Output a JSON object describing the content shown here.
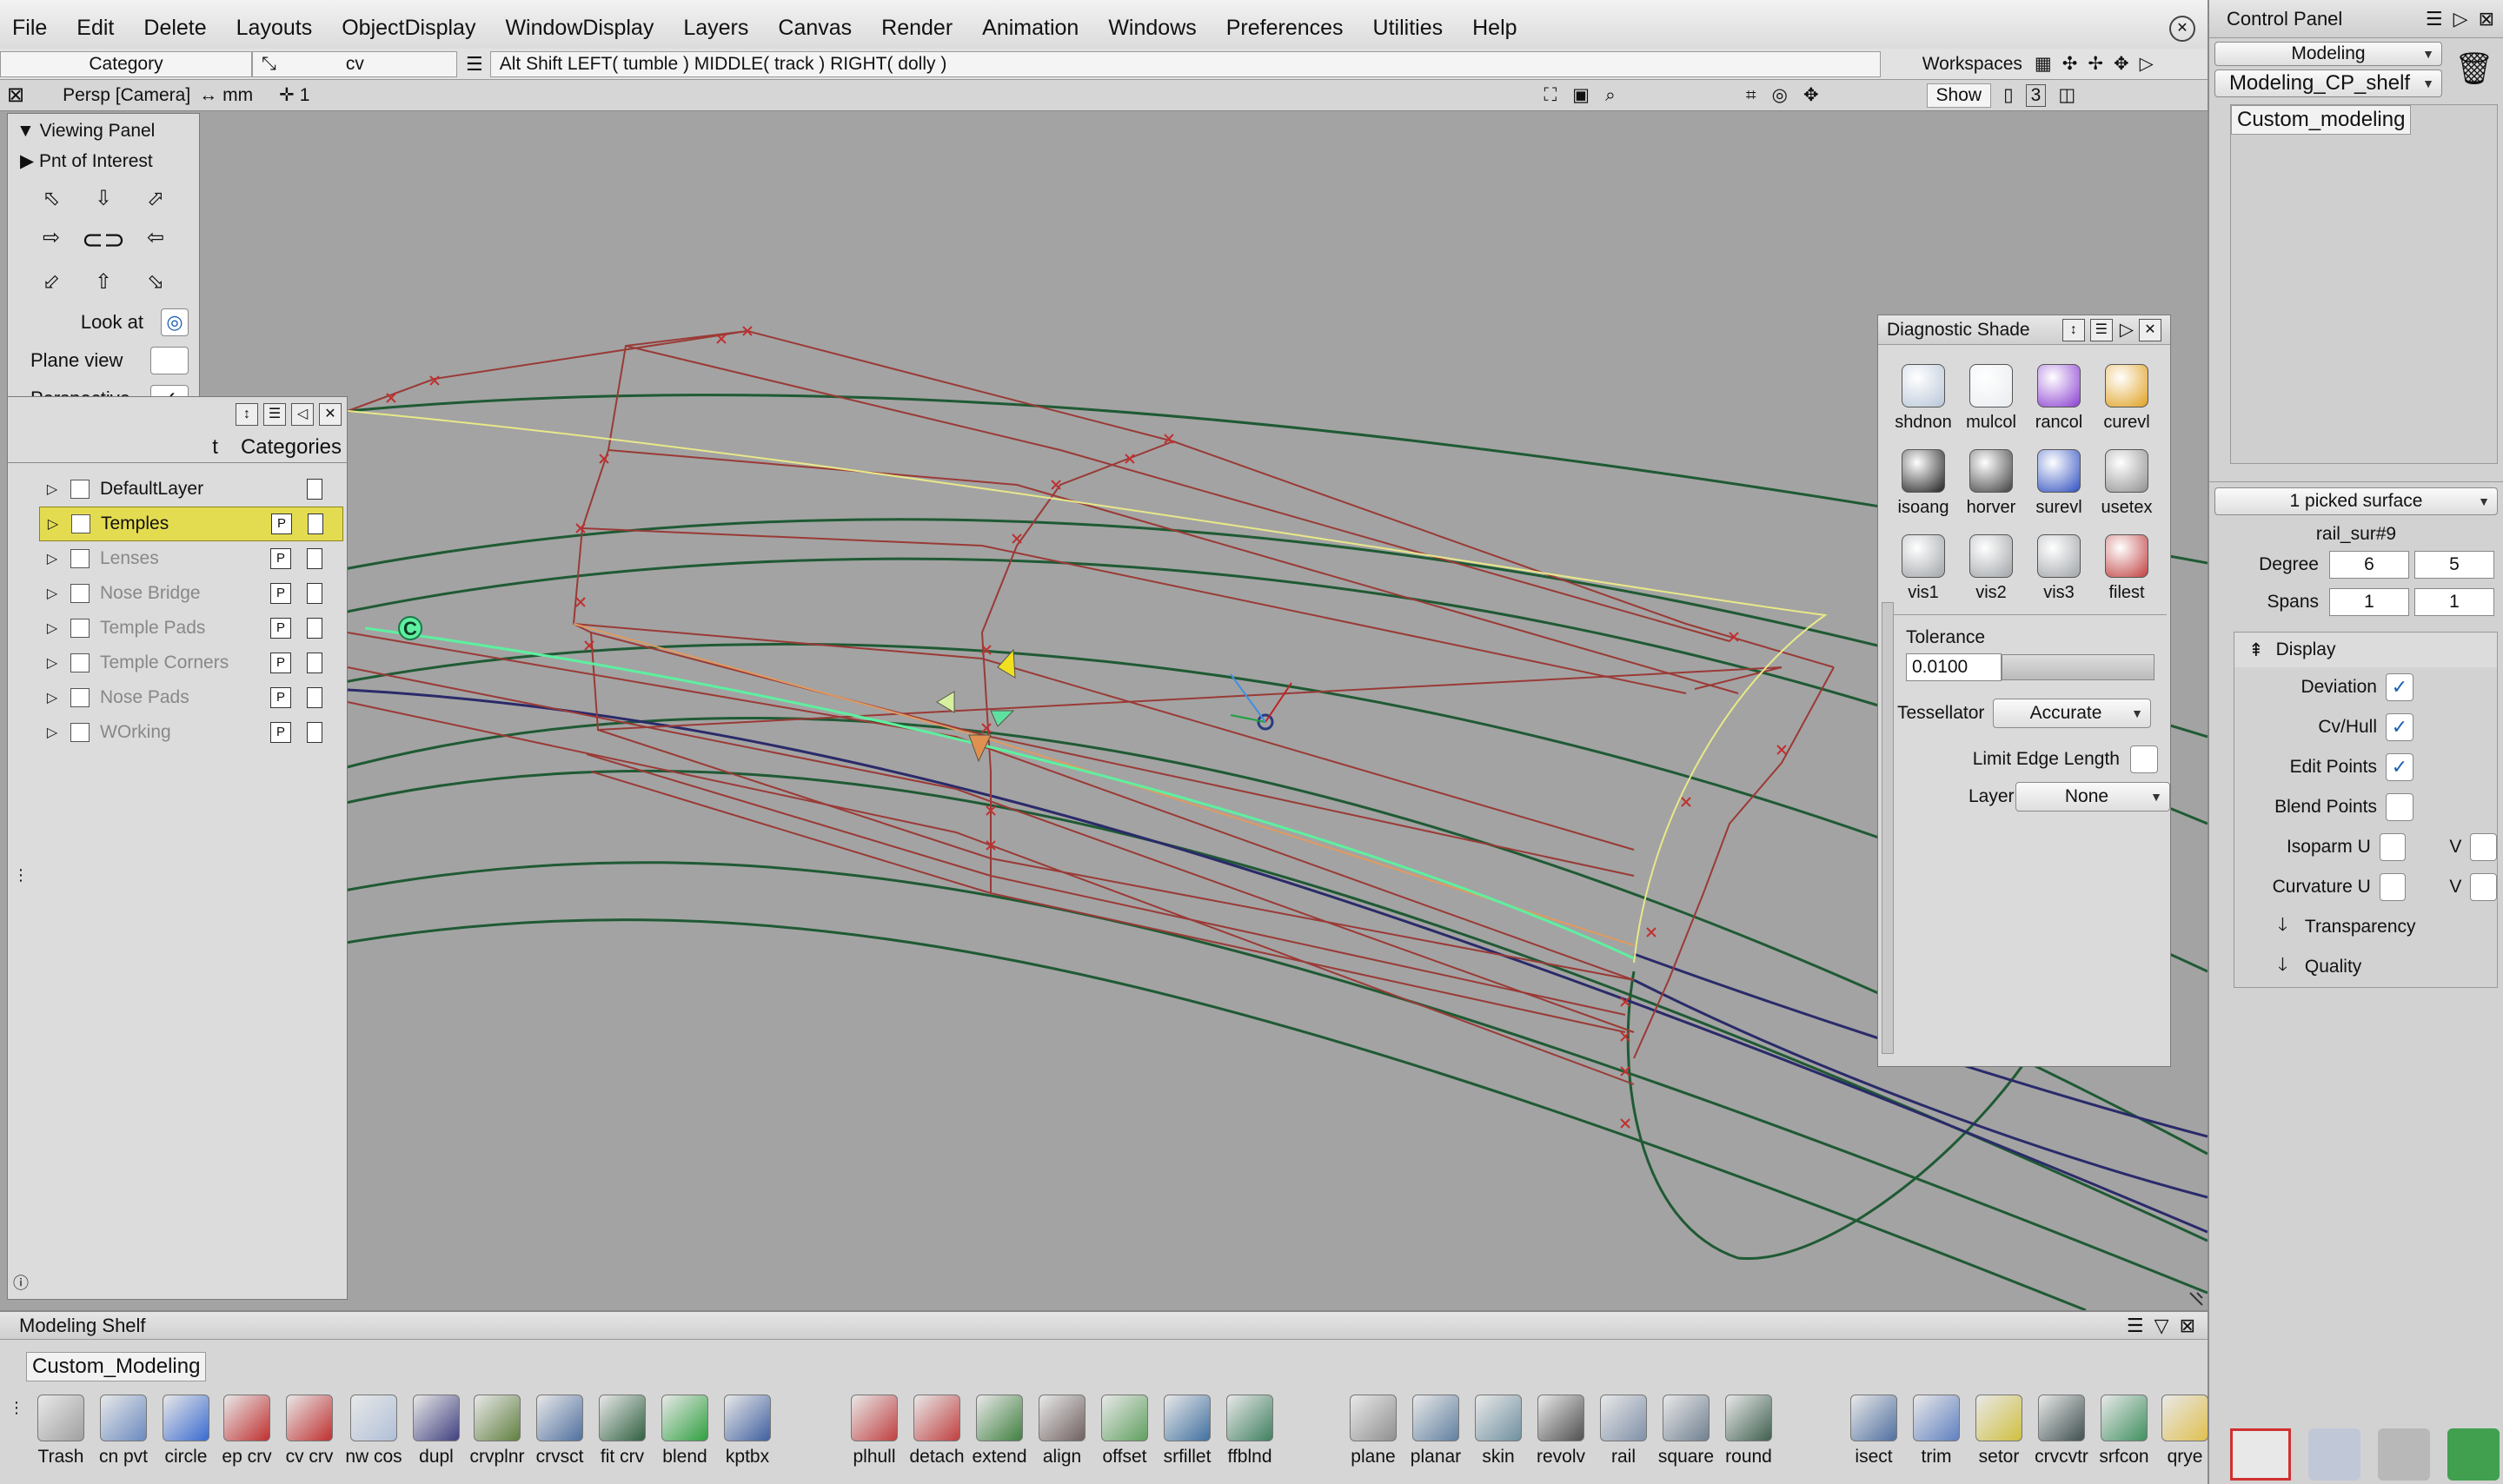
{
  "menu": [
    "File",
    "Edit",
    "Delete",
    "Layouts",
    "ObjectDisplay",
    "WindowDisplay",
    "Layers",
    "Canvas",
    "Render",
    "Animation",
    "Windows",
    "Preferences",
    "Utilities",
    "Help"
  ],
  "toolbar": {
    "category": "Category",
    "tool": "cv",
    "hint": "Alt Shift    LEFT( tumble )    MIDDLE( track )    RIGHT( dolly )",
    "workspaces": "Workspaces"
  },
  "viewport": {
    "camera": "Persp [Camera]",
    "units": "mm",
    "count": "1",
    "show_label": "Show",
    "layout_num": "3"
  },
  "viewing_panel": {
    "title": "Viewing Panel",
    "poi": "Pnt of Interest",
    "look_at": "Look at",
    "plane_view": "Plane view",
    "perspective": "Perspective"
  },
  "layers": {
    "tab_left": "t",
    "tab_right": "Categories",
    "items": [
      {
        "name": "DefaultLayer",
        "p": false,
        "selected": false,
        "dim": false
      },
      {
        "name": "Temples",
        "p": true,
        "selected": true,
        "dim": false
      },
      {
        "name": "Lenses",
        "p": true,
        "selected": false,
        "dim": true
      },
      {
        "name": "Nose Bridge",
        "p": true,
        "selected": false,
        "dim": true
      },
      {
        "name": "Temple Pads",
        "p": true,
        "selected": false,
        "dim": true
      },
      {
        "name": "Temple Corners",
        "p": true,
        "selected": false,
        "dim": true
      },
      {
        "name": "Nose Pads",
        "p": true,
        "selected": false,
        "dim": true
      },
      {
        "name": "WOrking",
        "p": true,
        "selected": false,
        "dim": true
      }
    ],
    "p_label": "P"
  },
  "diagnostic": {
    "title": "Diagnostic Shade",
    "tools": [
      {
        "label": "shdnon",
        "color": "#b8c6d8"
      },
      {
        "label": "mulcol",
        "color": "#e8ecf0"
      },
      {
        "label": "rancol",
        "color": "#8a3fd0"
      },
      {
        "label": "curevl",
        "color": "#e0a020"
      },
      {
        "label": "isoang",
        "color": "#202020"
      },
      {
        "label": "horver",
        "color": "#404040"
      },
      {
        "label": "surevl",
        "color": "#3050c0"
      },
      {
        "label": "usetex",
        "color": "#909090"
      },
      {
        "label": "vis1",
        "color": "#a0a4a8"
      },
      {
        "label": "vis2",
        "color": "#a0a4a8"
      },
      {
        "label": "vis3",
        "color": "#a0a4a8"
      },
      {
        "label": "filest",
        "color": "#c04040"
      }
    ],
    "tolerance_label": "Tolerance",
    "tolerance_value": "0.0100",
    "tessellator_label": "Tessellator",
    "tessellator_value": "Accurate",
    "limit_edge_label": "Limit Edge Length",
    "layer_label": "Layer",
    "layer_value": "None"
  },
  "control_panel": {
    "title": "Control Panel",
    "mode": "Modeling",
    "shelf_name": "Modeling_CP_shelf",
    "custom_tab": "Custom_modeling",
    "picked": "1 picked surface",
    "object_name": "rail_sur#9",
    "degree_label": "Degree",
    "degree_u": "6",
    "degree_v": "5",
    "spans_label": "Spans",
    "spans_u": "1",
    "spans_v": "1",
    "display_label": "Display",
    "deviation": "Deviation",
    "cvhull": "Cv/Hull",
    "edit_points": "Edit Points",
    "blend_points": "Blend Points",
    "isoparm_u": "Isoparm U",
    "curvature_u": "Curvature U",
    "v_label": "V",
    "transparency": "Transparency",
    "quality": "Quality"
  },
  "shelf": {
    "title": "Modeling Shelf",
    "tab": "Custom_Modeling",
    "tools": [
      "Trash",
      "cn pvt",
      "circle",
      "ep crv",
      "cv crv",
      "nw cos",
      "dupl",
      "crvplnr",
      "crvsct",
      "fit crv",
      "blend",
      "kptbx",
      "plhull",
      "detach",
      "extend",
      "align",
      "offset",
      "srfillet",
      "ffblnd",
      "plane",
      "planar",
      "skin",
      "revolv",
      "rail",
      "square",
      "round",
      "isect",
      "trim",
      "setor",
      "crvcvtr",
      "srfcon",
      "qrye"
    ]
  },
  "colors": {
    "viewport_bg": "#a3a3a3",
    "hull_red": "#9a3a36",
    "curve_green": "#1f5a34",
    "highlight_green": "#5ef0a0",
    "selection_yellow": "#e8e030"
  }
}
